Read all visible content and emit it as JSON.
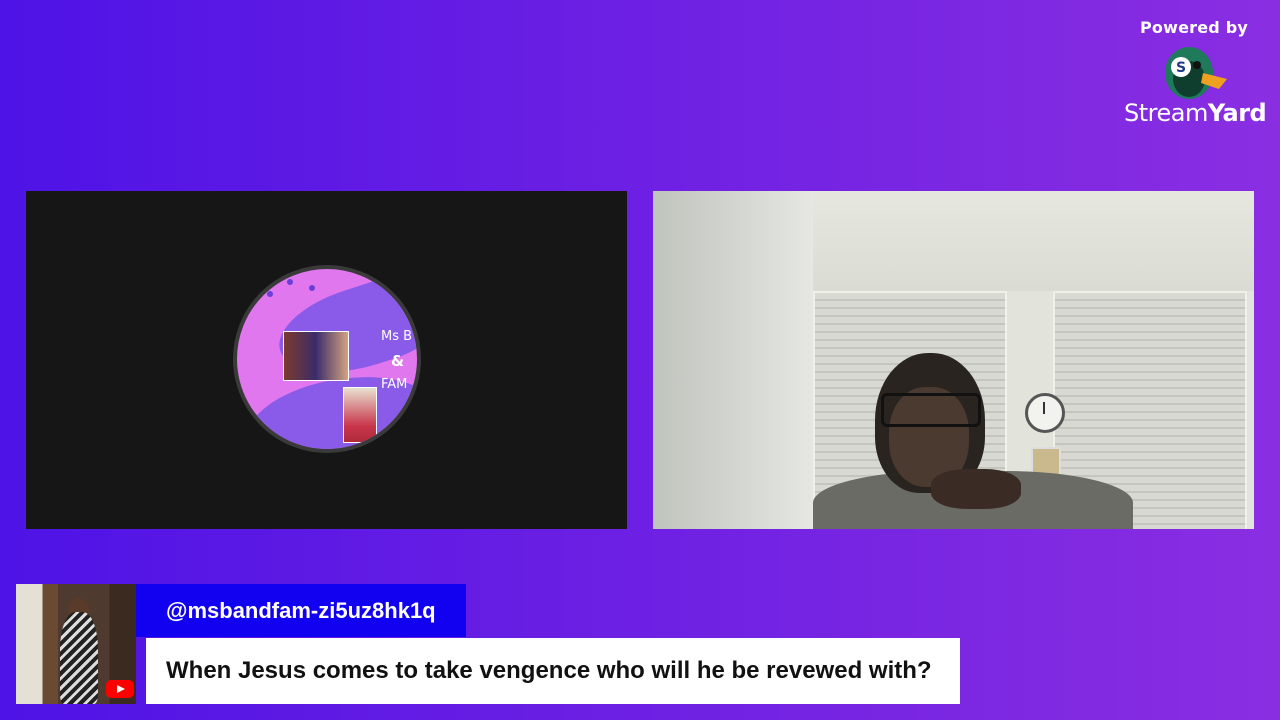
{
  "branding": {
    "powered_by": "Powered by",
    "logo_stream": "Stream",
    "logo_yard": "Yard",
    "icon": "streamyard-duck-icon",
    "colors": {
      "duck_green": "#1f7a5c",
      "beak": "#f0a020"
    }
  },
  "stage": {
    "left_tile": {
      "logo_line1": "Ms B",
      "logo_line2": "&",
      "logo_line3": "FAM"
    },
    "right_tile": {
      "description": "webcam"
    }
  },
  "comment": {
    "username": "@msbandfam-zi5uz8hk1q",
    "message": "When Jesus comes to take vengence who will he be revewed with?",
    "platform_icon": "youtube-icon",
    "colors": {
      "username_bg": "#1200f0",
      "message_bg": "#ffffff"
    }
  },
  "colors": {
    "background_start": "#4e13e6",
    "background_end": "#8a2ee2"
  }
}
